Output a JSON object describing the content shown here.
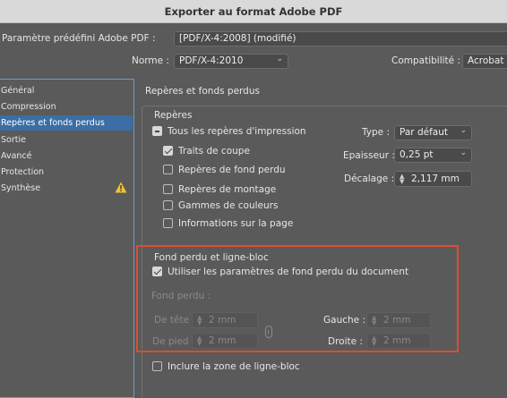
{
  "window": {
    "title": "Exporter au format Adobe PDF"
  },
  "preset": {
    "label": "Paramètre prédéfini Adobe PDF :",
    "value": "[PDF/X-4:2008] (modifié)"
  },
  "norme": {
    "label": "Norme :",
    "value": "PDF/X-4:2010"
  },
  "compat": {
    "label": "Compatibilité :",
    "value": "Acrobat"
  },
  "sidebar": {
    "items": [
      {
        "label": "Général"
      },
      {
        "label": "Compression"
      },
      {
        "label": "Repères et fonds perdus"
      },
      {
        "label": "Sortie"
      },
      {
        "label": "Avancé"
      },
      {
        "label": "Protection"
      },
      {
        "label": "Synthèse"
      }
    ],
    "selected_index": 2
  },
  "panel": {
    "title": "Repères et fonds perdus"
  },
  "reperes": {
    "title": "Repères",
    "all": "Tous les repères d'impression",
    "traits": "Traits de coupe",
    "fond_perdu": "Repères de fond perdu",
    "montage": "Repères de montage",
    "gammes": "Gammes de couleurs",
    "infos": "Informations sur la page",
    "type_label": "Type :",
    "type_value": "Par défaut",
    "epaisseur_label": "Epaisseur :",
    "epaisseur_value": "0,25 pt",
    "decalage_label": "Décalage :",
    "decalage_value": "2,117 mm"
  },
  "fond": {
    "title": "Fond perdu et ligne-bloc",
    "use_doc": "Utiliser les paramètres de fond perdu du document",
    "fond_label": "Fond perdu :",
    "tete_label": "De tête :",
    "tete_value": "2 mm",
    "pied_label": "De pied :",
    "pied_value": "2 mm",
    "gauche_label": "Gauche :",
    "gauche_value": "2 mm",
    "droite_label": "Droite :",
    "droite_value": "2 mm",
    "include": "Inclure la zone de ligne-bloc"
  },
  "colors": {
    "selection": "#3a6ea5",
    "highlight": "#e04b2f",
    "warning": "#f2c12e"
  }
}
